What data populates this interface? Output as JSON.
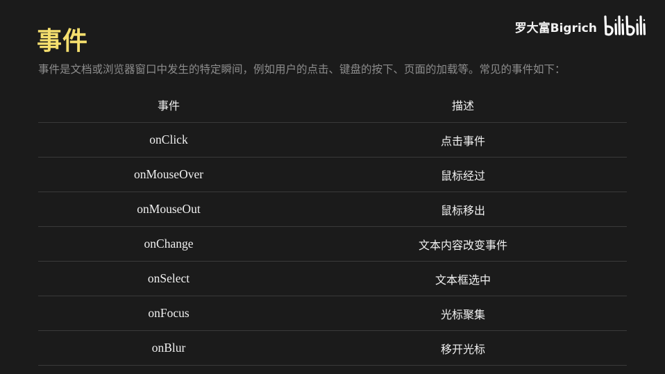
{
  "slide": {
    "title": "事件",
    "subtitle": "事件是文档或浏览器窗口中发生的特定瞬间，例如用户的点击、键盘的按下、页面的加载等。常见的事件如下："
  },
  "brand": {
    "name": "罗大富Bigrich",
    "logo_text": "bilibili",
    "logo_icon": "bilibili-logo-icon"
  },
  "table": {
    "headers": [
      "事件",
      "描述"
    ],
    "rows": [
      {
        "event": "onClick",
        "desc": "点击事件"
      },
      {
        "event": "onMouseOver",
        "desc": "鼠标经过"
      },
      {
        "event": "onMouseOut",
        "desc": "鼠标移出"
      },
      {
        "event": "onChange",
        "desc": "文本内容改变事件"
      },
      {
        "event": "onSelect",
        "desc": "文本框选中"
      },
      {
        "event": "onFocus",
        "desc": "光标聚集"
      },
      {
        "event": "onBlur",
        "desc": "移开光标"
      }
    ]
  },
  "colors": {
    "background": "#1b1b1b",
    "title": "#f5df6e",
    "subtitle": "#8c8c8c",
    "text": "#f0f0f0",
    "divider": "#3a3a3a"
  }
}
